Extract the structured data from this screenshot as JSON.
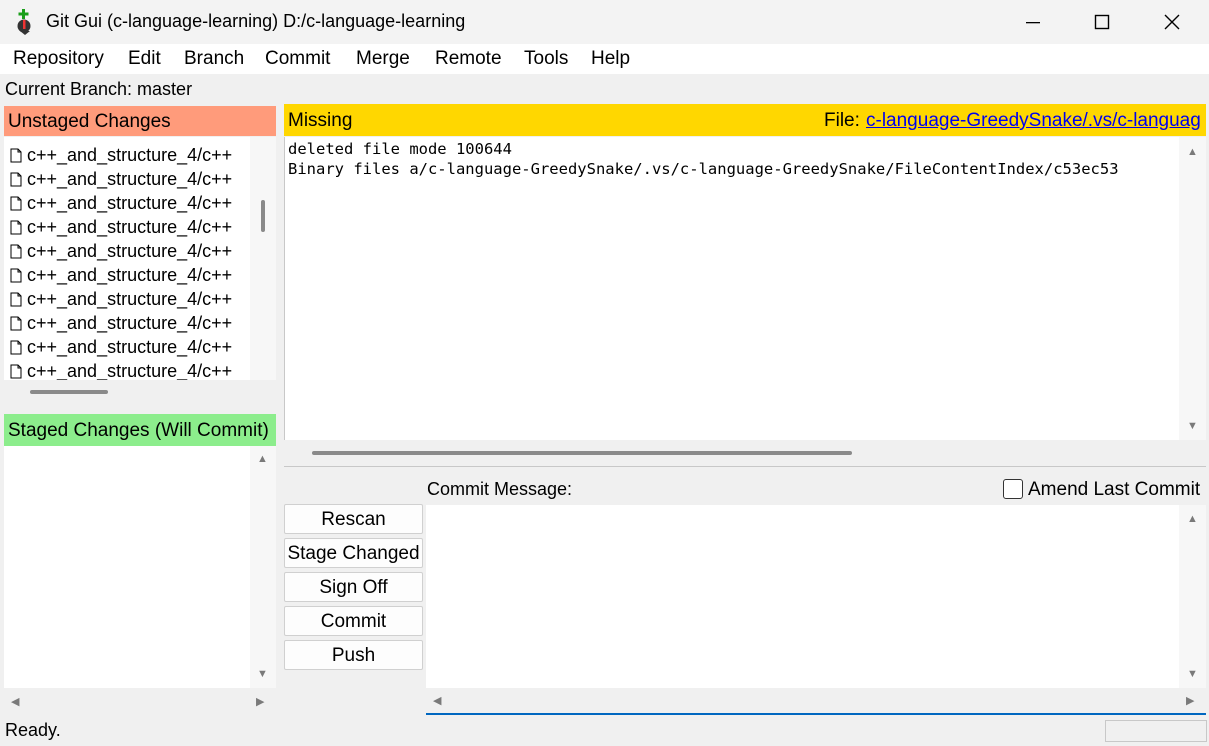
{
  "window": {
    "title": "Git Gui (c-language-learning) D:/c-language-learning",
    "minimize": "—",
    "maximize": "☐",
    "close": "✕"
  },
  "menu": [
    "Repository",
    "Edit",
    "Branch",
    "Commit",
    "Merge",
    "Remote",
    "Tools",
    "Help"
  ],
  "current_branch": "Current Branch: master",
  "unstaged": {
    "header": "Unstaged Changes",
    "files": [
      "c++_and_structure_4/c++",
      "c++_and_structure_4/c++",
      "c++_and_structure_4/c++",
      "c++_and_structure_4/c++",
      "c++_and_structure_4/c++",
      "c++_and_structure_4/c++",
      "c++_and_structure_4/c++",
      "c++_and_structure_4/c++",
      "c++_and_structure_4/c++",
      "c++_and_structure_4/c++"
    ]
  },
  "staged": {
    "header": "Staged Changes (Will Commit)"
  },
  "diff": {
    "status": "Missing",
    "file_label": "File:",
    "file_path": "c-language-GreedySnake/.vs/c-languag",
    "lines": [
      "deleted file mode 100644",
      "Binary files a/c-language-GreedySnake/.vs/c-language-GreedySnake/FileContentIndex/c53ec53"
    ]
  },
  "commit": {
    "message_label": "Commit Message:",
    "amend_label": "Amend Last Commit",
    "buttons": [
      "Rescan",
      "Stage Changed",
      "Sign Off",
      "Commit",
      "Push"
    ]
  },
  "status": "Ready.",
  "arrows": {
    "up": "▲",
    "down": "▼",
    "left": "◀",
    "right": "▶"
  }
}
